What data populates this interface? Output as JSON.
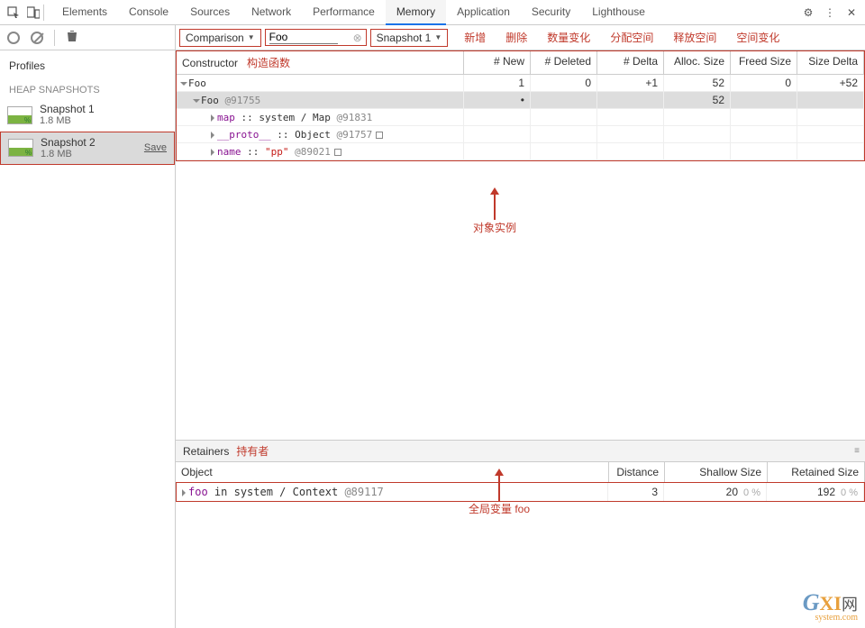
{
  "topbar": {
    "tabs": [
      "Elements",
      "Console",
      "Sources",
      "Network",
      "Performance",
      "Memory",
      "Application",
      "Security",
      "Lighthouse"
    ],
    "active_index": 5
  },
  "sidebar": {
    "title": "Profiles",
    "section": "HEAP SNAPSHOTS",
    "snapshots": [
      {
        "name": "Snapshot 1",
        "size": "1.8 MB",
        "selected": false
      },
      {
        "name": "Snapshot 2",
        "size": "1.8 MB",
        "selected": true,
        "save": "Save"
      }
    ]
  },
  "toolbar2": {
    "view": "Comparison",
    "filter": "Foo",
    "base": "Snapshot 1",
    "legend": [
      "新增",
      "删除",
      "数量变化",
      "分配空间",
      "释放空间",
      "空间变化"
    ]
  },
  "table": {
    "headers": {
      "constructor_label": "Constructor",
      "constructor_ann": "构造函数",
      "new": "# New",
      "deleted": "# Deleted",
      "delta": "# Delta",
      "alloc": "Alloc. Size",
      "freed": "Freed Size",
      "sized": "Size Delta"
    },
    "rows": [
      {
        "lvl": 0,
        "expand": "down",
        "label": "Foo",
        "new": "1",
        "deleted": "0",
        "delta": "+1",
        "alloc": "52",
        "freed": "0",
        "sized": "+52"
      },
      {
        "lvl": 1,
        "expand": "down",
        "label": "Foo",
        "id": "@91755",
        "new": "•",
        "deleted": "",
        "delta": "",
        "alloc": "52",
        "freed": "",
        "sized": ""
      },
      {
        "lvl": 2,
        "expand": "right",
        "label": "map",
        "sep": "::",
        "type": "system / Map",
        "id": "@91831"
      },
      {
        "lvl": 2,
        "expand": "right",
        "label": "__proto__",
        "sep": "::",
        "type": "Object",
        "id": "@91757",
        "box": true
      },
      {
        "lvl": 2,
        "expand": "right",
        "label": "name",
        "sep": "::",
        "val": "\"pp\"",
        "id": "@89021",
        "box": true
      }
    ]
  },
  "annotations": {
    "instance": "对象实例",
    "globalvar": "全局变量 foo"
  },
  "retainers": {
    "title": "Retainers",
    "ann": "持有者",
    "headers": {
      "object": "Object",
      "distance": "Distance",
      "shallow": "Shallow Size",
      "retained": "Retained Size"
    },
    "row": {
      "key": "foo",
      "mid": "in",
      "type": "system / Context",
      "id": "@89117",
      "distance": "3",
      "shallow": "20",
      "shallow_pct": "0 %",
      "retained": "192",
      "retained_pct": "0 %"
    }
  },
  "watermark": {
    "g": "G",
    "xi": "XI",
    "cn": "网",
    "sub": "system.com"
  }
}
